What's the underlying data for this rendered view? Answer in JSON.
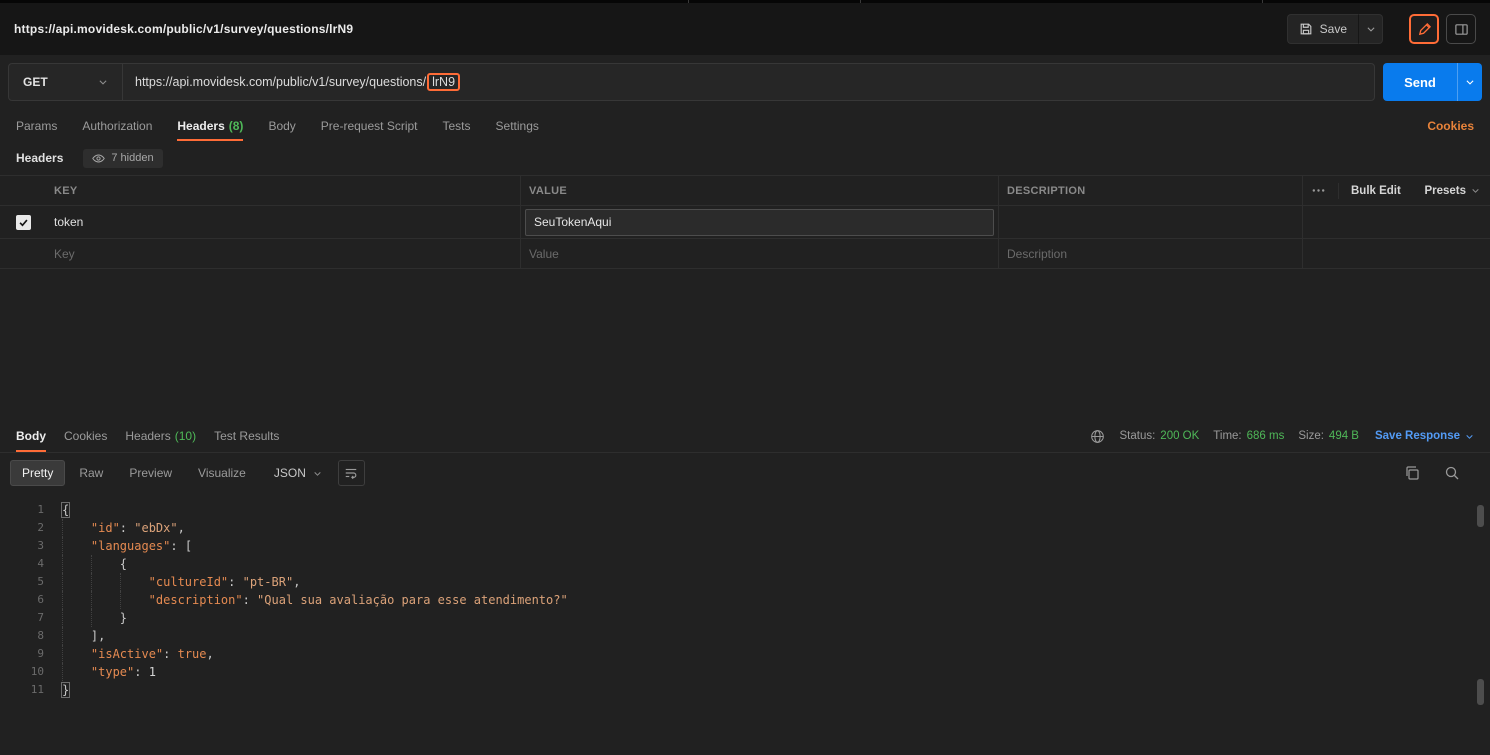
{
  "colors": {
    "accent_orange": "#ff6c37",
    "send_button_blue": "#097bed",
    "success_green": "#4fb858",
    "link_blue": "#539bf5",
    "json_key_orange": "#e58a51",
    "json_string_orange": "#dba279"
  },
  "topbar": {
    "title": "https://api.movidesk.com/public/v1/survey/questions/lrN9",
    "save_label": "Save"
  },
  "request": {
    "method": "GET",
    "url_base": "https://api.movidesk.com/public/v1/survey/questions/",
    "url_highlighted": "lrN9",
    "send_label": "Send"
  },
  "request_tabs": {
    "params": "Params",
    "authorization": "Authorization",
    "headers": "Headers",
    "headers_count": "(8)",
    "body": "Body",
    "prerequest_script": "Pre-request Script",
    "tests": "Tests",
    "settings": "Settings",
    "cookies_link": "Cookies"
  },
  "headers_editor": {
    "section_title": "Headers",
    "hidden_badge": "7 hidden",
    "columns": {
      "key": "KEY",
      "value": "VALUE",
      "description": "DESCRIPTION"
    },
    "bulk_edit_label": "Bulk Edit",
    "presets_label": "Presets",
    "row1": {
      "key": "token",
      "value": "SeuTokenAqui",
      "description": ""
    },
    "placeholder_row": {
      "key": "Key",
      "value": "Value",
      "description": "Description"
    }
  },
  "response": {
    "tabs": {
      "body": "Body",
      "cookies": "Cookies",
      "headers": "Headers",
      "headers_count": "(10)",
      "test_results": "Test Results"
    },
    "meta": {
      "status_label": "Status:",
      "status_value": "200 OK",
      "time_label": "Time:",
      "time_value": "686 ms",
      "size_label": "Size:",
      "size_value": "494 B",
      "save_response_label": "Save Response"
    },
    "view_tabs": {
      "pretty": "Pretty",
      "raw": "Raw",
      "preview": "Preview",
      "visualize": "Visualize"
    },
    "format": "JSON"
  },
  "code": {
    "lines": [
      {
        "n": "1",
        "indent": 0,
        "tokens": [
          [
            "pm",
            "{"
          ]
        ]
      },
      {
        "n": "2",
        "indent": 4,
        "tokens": [
          [
            "k",
            "\"id\""
          ],
          [
            "p",
            ": "
          ],
          [
            "s",
            "\"ebDx\""
          ],
          [
            "p",
            ","
          ]
        ]
      },
      {
        "n": "3",
        "indent": 4,
        "tokens": [
          [
            "k",
            "\"languages\""
          ],
          [
            "p",
            ": ["
          ]
        ]
      },
      {
        "n": "4",
        "indent": 8,
        "tokens": [
          [
            "p",
            "{"
          ]
        ]
      },
      {
        "n": "5",
        "indent": 12,
        "tokens": [
          [
            "k",
            "\"cultureId\""
          ],
          [
            "p",
            ": "
          ],
          [
            "s",
            "\"pt-BR\""
          ],
          [
            "p",
            ","
          ]
        ]
      },
      {
        "n": "6",
        "indent": 12,
        "tokens": [
          [
            "k",
            "\"description\""
          ],
          [
            "p",
            ": "
          ],
          [
            "s",
            "\"Qual sua avaliação para esse atendimento?\""
          ]
        ]
      },
      {
        "n": "7",
        "indent": 8,
        "tokens": [
          [
            "p",
            "}"
          ]
        ]
      },
      {
        "n": "8",
        "indent": 4,
        "tokens": [
          [
            "p",
            "],"
          ]
        ]
      },
      {
        "n": "9",
        "indent": 4,
        "tokens": [
          [
            "k",
            "\"isActive\""
          ],
          [
            "p",
            ": "
          ],
          [
            "b",
            "true"
          ],
          [
            "p",
            ","
          ]
        ]
      },
      {
        "n": "10",
        "indent": 4,
        "tokens": [
          [
            "k",
            "\"type\""
          ],
          [
            "p",
            ": "
          ],
          [
            "num",
            "1"
          ]
        ]
      },
      {
        "n": "11",
        "indent": 0,
        "tokens": [
          [
            "pm",
            "}"
          ]
        ]
      }
    ]
  }
}
